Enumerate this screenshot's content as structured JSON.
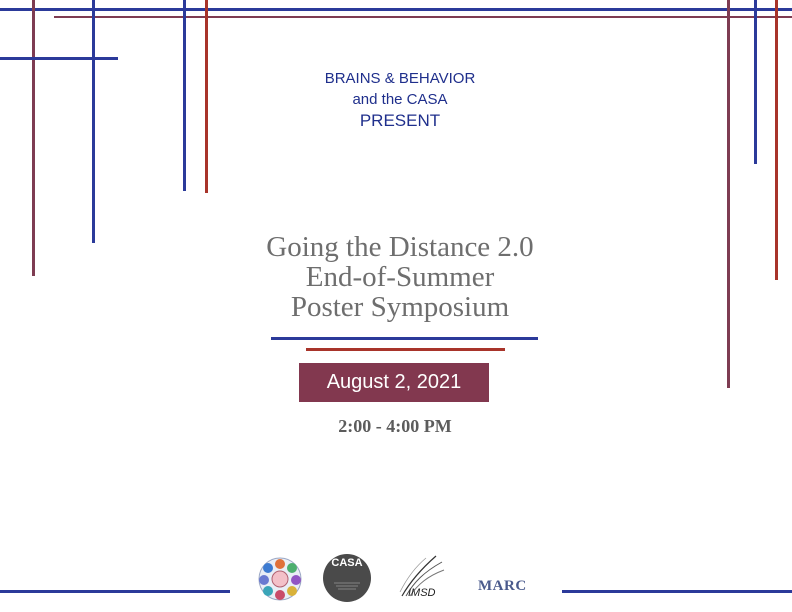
{
  "presenters": {
    "line1": "BRAINS & BEHAVIOR",
    "line2": "and the CASA",
    "line3": "PRESENT"
  },
  "event": {
    "title_line1": "Going the Distance 2.0",
    "title_line2": "End-of-Summer",
    "title_line3": "Poster Symposium",
    "date": "August 2, 2021",
    "time": "2:00 - 4:00 PM"
  },
  "sponsors": {
    "casa": "CASA",
    "imsd": "IMSD",
    "marc": "MARC"
  },
  "colors": {
    "blue": "#2b3a9a",
    "red": "#a8342a",
    "maroon": "#7e3c52",
    "date_box": "#82384f"
  }
}
